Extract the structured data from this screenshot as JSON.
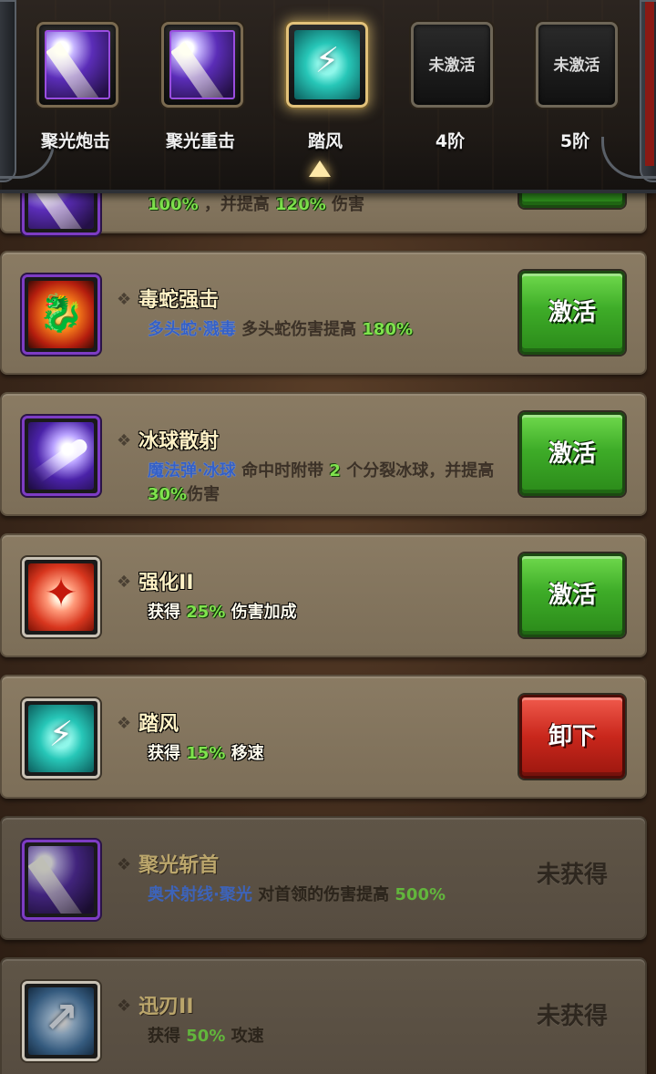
{
  "header": {
    "slots": [
      {
        "label": "聚光炮击",
        "state": "filled",
        "icon": "focus-beam-icon"
      },
      {
        "label": "聚光重击",
        "state": "filled",
        "icon": "focus-beam-icon"
      },
      {
        "label": "踏风",
        "state": "selected",
        "icon": "wind-boot-icon"
      },
      {
        "label": "4阶",
        "state": "empty",
        "empty_text": "未激活"
      },
      {
        "label": "5阶",
        "state": "empty",
        "empty_text": "未激活"
      }
    ]
  },
  "cards": [
    {
      "partial": true,
      "desc_parts": [
        {
          "text": "100%",
          "style": "green"
        },
        {
          "text": " ，并提高 ",
          "style": "dark"
        },
        {
          "text": "120%",
          "style": "green"
        },
        {
          "text": " 伤害",
          "style": "dark"
        }
      ]
    },
    {
      "title": "毒蛇强击",
      "icon": "fire-dragon-icon",
      "desc_parts": [
        {
          "text": "多头蛇·溅毒",
          "style": "blue"
        },
        {
          "text": " 多头蛇伤害提高 ",
          "style": "dark"
        },
        {
          "text": "180%",
          "style": "green"
        }
      ],
      "button": "激活",
      "button_style": "green"
    },
    {
      "title": "冰球散射",
      "icon": "comet-icon",
      "desc_parts": [
        {
          "text": "魔法弹·冰球",
          "style": "blue"
        },
        {
          "text": " 命中时附带 ",
          "style": "dark"
        },
        {
          "text": "2",
          "style": "green"
        },
        {
          "text": " 个分裂冰球，并提高 ",
          "style": "dark"
        },
        {
          "text": "30%",
          "style": "green"
        },
        {
          "text": "伤害",
          "style": "dark"
        }
      ],
      "button": "激活",
      "button_style": "green"
    },
    {
      "title": "强化II",
      "icon": "power-burst-icon",
      "desc_parts": [
        {
          "text": "获得 ",
          "style": "white"
        },
        {
          "text": "25%",
          "style": "green"
        },
        {
          "text": " 伤害加成",
          "style": "white"
        }
      ],
      "button": "激活",
      "button_style": "green"
    },
    {
      "title": "踏风",
      "icon": "wind-boot-icon",
      "desc_parts": [
        {
          "text": "获得 ",
          "style": "white"
        },
        {
          "text": "15%",
          "style": "green"
        },
        {
          "text": " 移速",
          "style": "white"
        }
      ],
      "button": "卸下",
      "button_style": "red"
    },
    {
      "title": "聚光斩首",
      "icon": "focus-beam-icon",
      "locked": true,
      "desc_parts": [
        {
          "text": "奥术射线·聚光",
          "style": "blue"
        },
        {
          "text": " 对首领的伤害提高 ",
          "style": "dark"
        },
        {
          "text": "500%",
          "style": "green"
        }
      ],
      "button": "未获得",
      "button_style": "locked"
    },
    {
      "title": "迅刃II",
      "icon": "swift-blade-icon",
      "locked": true,
      "desc_parts": [
        {
          "text": "获得 ",
          "style": "white"
        },
        {
          "text": "50%",
          "style": "green"
        },
        {
          "text": " 攻速",
          "style": "white"
        }
      ],
      "button": "未获得",
      "button_style": "locked"
    }
  ],
  "colors": {
    "green_button": "#3eac28",
    "red_button": "#c9271c",
    "value_green": "#7fe34d",
    "skill_blue": "#3460c6",
    "title_cream": "#fff2c6"
  }
}
